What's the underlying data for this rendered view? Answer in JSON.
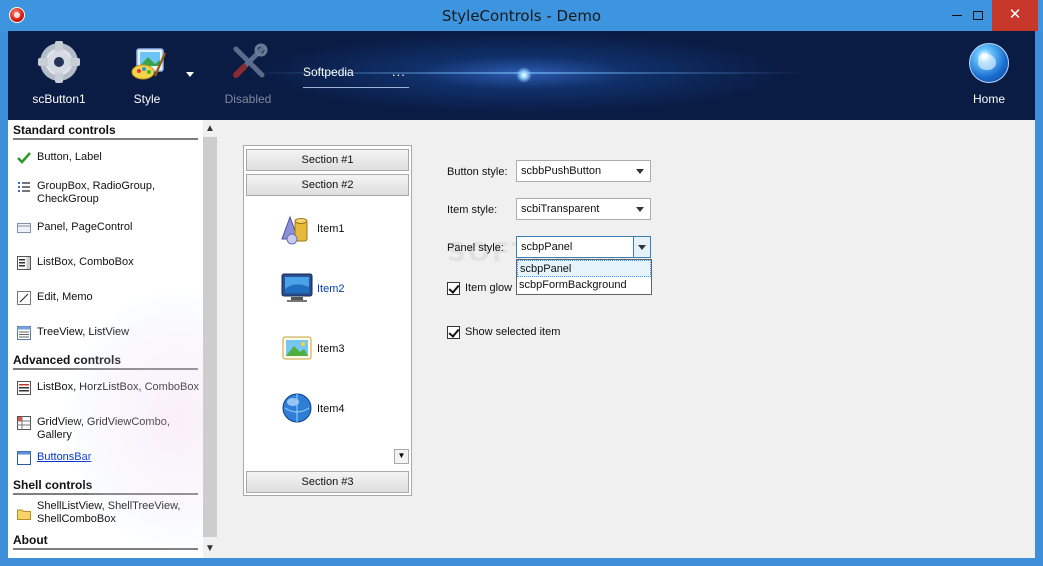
{
  "window": {
    "title": "StyleControls - Demo",
    "controls": {
      "minimize": "minimize",
      "maximize": "maximize",
      "close": "✕"
    }
  },
  "toolbar": {
    "buttons": [
      {
        "label": "scButton1",
        "icon": "gear-icon"
      },
      {
        "label": "Style",
        "icon": "paint-palette-icon"
      },
      {
        "label": "Disabled",
        "icon": "tools-icon"
      },
      {
        "label": "Home",
        "icon": "globe-icon"
      }
    ],
    "edit_value": "Softpedia",
    "edit_button": "..."
  },
  "sidebar": {
    "groups": [
      {
        "header": "Standard controls",
        "items": [
          {
            "label": "Button, Label",
            "icon": "checkmark-icon"
          },
          {
            "label": "GroupBox, RadioGroup, CheckGroup",
            "icon": "list-icon"
          },
          {
            "label": "Panel, PageControl",
            "icon": "panel-icon"
          },
          {
            "label": "ListBox, ComboBox",
            "icon": "listbox-icon"
          },
          {
            "label": "Edit, Memo",
            "icon": "edit-icon"
          },
          {
            "label": "TreeView, ListView",
            "icon": "treeview-icon"
          }
        ]
      },
      {
        "header": "Advanced controls",
        "items": [
          {
            "label": "ListBox, HorzListBox, ComboBox",
            "icon": "listbox-icon"
          },
          {
            "label": "GridView, GridViewCombo, Gallery",
            "icon": "grid-icon"
          },
          {
            "label": "ButtonsBar",
            "icon": "buttonsbar-icon"
          }
        ]
      },
      {
        "header": "Shell controls",
        "items": [
          {
            "label": "ShellListView, ShellTreeView, ShellComboBox",
            "icon": "folder-icon"
          }
        ]
      },
      {
        "header": "About",
        "items": []
      }
    ],
    "scroll_up": "▲",
    "scroll_down": "▼"
  },
  "buttonsbar": {
    "sections": [
      "Section #1",
      "Section #2",
      "Section #3"
    ],
    "items": [
      {
        "label": "Item1",
        "icon": "shapes-icon"
      },
      {
        "label": "Item2",
        "icon": "monitor-icon"
      },
      {
        "label": "Item3",
        "icon": "picture-icon"
      },
      {
        "label": "Item4",
        "icon": "globe-icon"
      }
    ],
    "selected_item": "Item2",
    "scroll_button": "▼"
  },
  "options": {
    "button_style": {
      "label": "Button style:",
      "value": "scbbPushButton"
    },
    "item_style": {
      "label": "Item style:",
      "value": "scbiTransparent"
    },
    "panel_style": {
      "label": "Panel style:",
      "value": "scbpPanel",
      "options": [
        "scbpPanel",
        "scbpFormBackground"
      ],
      "highlighted": "scbpPanel"
    },
    "item_glow": {
      "label": "Item glow",
      "checked": true
    },
    "show_selected": {
      "label": "Show selected item",
      "checked": true
    }
  },
  "watermark": "SOFTPEDIA",
  "colors": {
    "titlebar": "#3d95df",
    "banner": "#0a1c44",
    "close": "#c7382a",
    "link": "#0033cc"
  }
}
